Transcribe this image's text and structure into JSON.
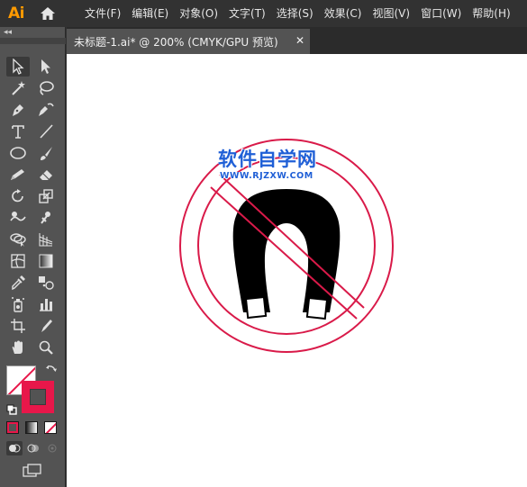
{
  "app": {
    "logo": "Ai"
  },
  "menu": {
    "items": [
      "文件(F)",
      "编辑(E)",
      "对象(O)",
      "文字(T)",
      "选择(S)",
      "效果(C)",
      "视图(V)",
      "窗口(W)",
      "帮助(H)"
    ]
  },
  "toolbar": {
    "collapse_label": "◂◂",
    "tools": [
      "selection-tool",
      "direct-selection-tool",
      "magic-wand-tool",
      "lasso-tool",
      "pen-tool",
      "curvature-tool",
      "type-tool",
      "line-segment-tool",
      "ellipse-tool",
      "paintbrush-tool",
      "pencil-tool",
      "eraser-tool",
      "rotate-tool",
      "scale-tool",
      "warp-tool",
      "puppet-warp-tool",
      "shape-builder-tool",
      "perspective-grid-tool",
      "mesh-tool",
      "gradient-tool",
      "eyedropper-tool",
      "blend-tool",
      "symbol-sprayer-tool",
      "column-graph-tool",
      "artboard-tool",
      "slice-tool",
      "hand-tool",
      "zoom-tool"
    ],
    "fill_color": "none",
    "stroke_color": "#e8174a"
  },
  "tab": {
    "label": "未标题-1.ai* @ 200% (CMYK/GPU 预览)",
    "close": "✕"
  },
  "canvas": {
    "watermark_title": "软件自学网",
    "watermark_url": "WWW.RJZXW.COM",
    "accent_color": "#d91a49",
    "shape_color": "#000000"
  }
}
